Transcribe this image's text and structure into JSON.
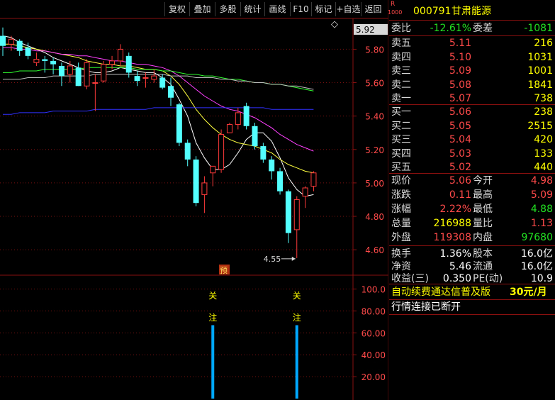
{
  "toolbar": {
    "buttons": [
      "复权",
      "叠加",
      "多股",
      "统计",
      "画线",
      "F10",
      "标记",
      "+自选",
      "返回"
    ]
  },
  "stock": {
    "badge_top": "R",
    "badge_bottom": "1000",
    "code": "000791",
    "name": "甘肃能源"
  },
  "price_axis": {
    "ticks": [
      "5.80",
      "5.60",
      "5.40",
      "5.20",
      "5.00",
      "4.80",
      "4.60"
    ],
    "current_tag": "5.92"
  },
  "chart_labels": {
    "low_label": "4.55",
    "preview_badge": "预",
    "diamond_icon": "◇"
  },
  "indicator": {
    "ticks": [
      "100.0",
      "80.00",
      "60.00",
      "40.00",
      "20.00"
    ],
    "marker_top": "关",
    "marker_bottom": "注"
  },
  "chart_data": {
    "type": "candlestick",
    "price_range": [
      4.52,
      5.98
    ],
    "candles": [
      {
        "o": 5.88,
        "h": 5.93,
        "l": 5.76,
        "c": 5.82
      },
      {
        "o": 5.83,
        "h": 5.88,
        "l": 5.79,
        "c": 5.86
      },
      {
        "o": 5.85,
        "h": 5.86,
        "l": 5.76,
        "c": 5.79
      },
      {
        "o": 5.81,
        "h": 5.84,
        "l": 5.74,
        "c": 5.76
      },
      {
        "o": 5.72,
        "h": 5.78,
        "l": 5.7,
        "c": 5.74
      },
      {
        "o": 5.74,
        "h": 5.76,
        "l": 5.66,
        "c": 5.73
      },
      {
        "o": 5.73,
        "h": 5.75,
        "l": 5.65,
        "c": 5.71
      },
      {
        "o": 5.7,
        "h": 5.72,
        "l": 5.58,
        "c": 5.64
      },
      {
        "o": 5.65,
        "h": 5.73,
        "l": 5.6,
        "c": 5.7
      },
      {
        "o": 5.69,
        "h": 5.72,
        "l": 5.58,
        "c": 5.58
      },
      {
        "o": 5.58,
        "h": 5.74,
        "l": 5.56,
        "c": 5.72
      },
      {
        "o": 5.6,
        "h": 5.65,
        "l": 5.43,
        "c": 5.6
      },
      {
        "o": 5.61,
        "h": 5.73,
        "l": 5.6,
        "c": 5.71
      },
      {
        "o": 5.71,
        "h": 5.76,
        "l": 5.68,
        "c": 5.73
      },
      {
        "o": 5.73,
        "h": 5.83,
        "l": 5.7,
        "c": 5.8
      },
      {
        "o": 5.76,
        "h": 5.78,
        "l": 5.63,
        "c": 5.66
      },
      {
        "o": 5.64,
        "h": 5.67,
        "l": 5.58,
        "c": 5.61
      },
      {
        "o": 5.63,
        "h": 5.66,
        "l": 5.57,
        "c": 5.63
      },
      {
        "o": 5.62,
        "h": 5.68,
        "l": 5.6,
        "c": 5.64
      },
      {
        "o": 5.63,
        "h": 5.65,
        "l": 5.56,
        "c": 5.57
      },
      {
        "o": 5.58,
        "h": 5.63,
        "l": 5.46,
        "c": 5.51
      },
      {
        "o": 5.47,
        "h": 5.48,
        "l": 5.22,
        "c": 5.24
      },
      {
        "o": 5.24,
        "h": 5.26,
        "l": 5.1,
        "c": 5.14
      },
      {
        "o": 5.14,
        "h": 5.16,
        "l": 4.86,
        "c": 4.88
      },
      {
        "o": 4.93,
        "h": 5.04,
        "l": 4.82,
        "c": 5.0
      },
      {
        "o": 5.06,
        "h": 5.08,
        "l": 4.98,
        "c": 5.1
      },
      {
        "o": 5.08,
        "h": 5.32,
        "l": 5.06,
        "c": 5.29
      },
      {
        "o": 5.3,
        "h": 5.36,
        "l": 5.3,
        "c": 5.35
      },
      {
        "o": 5.35,
        "h": 5.45,
        "l": 5.32,
        "c": 5.42
      },
      {
        "o": 5.46,
        "h": 5.48,
        "l": 5.32,
        "c": 5.34
      },
      {
        "o": 5.34,
        "h": 5.36,
        "l": 5.2,
        "c": 5.22
      },
      {
        "o": 5.22,
        "h": 5.24,
        "l": 5.12,
        "c": 5.14
      },
      {
        "o": 5.14,
        "h": 5.16,
        "l": 5.02,
        "c": 5.07
      },
      {
        "o": 5.07,
        "h": 5.09,
        "l": 4.93,
        "c": 4.95
      },
      {
        "o": 4.95,
        "h": 4.96,
        "l": 4.64,
        "c": 4.7
      },
      {
        "o": 4.72,
        "h": 4.92,
        "l": 4.55,
        "c": 4.9
      },
      {
        "o": 4.92,
        "h": 4.98,
        "l": 4.85,
        "c": 4.97
      },
      {
        "o": 4.98,
        "h": 5.07,
        "l": 4.95,
        "c": 5.06
      }
    ],
    "ma_series": [
      {
        "color": "#ffffff",
        "values": [
          5.88,
          5.87,
          5.84,
          5.82,
          5.8,
          5.78,
          5.75,
          5.73,
          5.71,
          5.69,
          5.67,
          5.66,
          5.66,
          5.67,
          5.69,
          5.68,
          5.67,
          5.66,
          5.66,
          5.63,
          5.59,
          5.5,
          5.4,
          5.24,
          5.15,
          5.08,
          5.08,
          5.11,
          5.18,
          5.26,
          5.3,
          5.3,
          5.25,
          5.15,
          5.03,
          4.96,
          4.92,
          4.93
        ]
      },
      {
        "color": "#ffff40",
        "values": [
          5.83,
          5.83,
          5.82,
          5.81,
          5.8,
          5.79,
          5.78,
          5.77,
          5.76,
          5.75,
          5.73,
          5.72,
          5.71,
          5.71,
          5.7,
          5.7,
          5.69,
          5.68,
          5.68,
          5.67,
          5.64,
          5.59,
          5.52,
          5.44,
          5.38,
          5.33,
          5.29,
          5.26,
          5.24,
          5.23,
          5.22,
          5.2,
          5.18,
          5.14,
          5.11,
          5.09,
          5.07,
          5.06
        ]
      },
      {
        "color": "#ff40ff",
        "values": [
          5.81,
          5.81,
          5.8,
          5.8,
          5.79,
          5.79,
          5.78,
          5.77,
          5.77,
          5.76,
          5.76,
          5.75,
          5.74,
          5.73,
          5.73,
          5.72,
          5.71,
          5.71,
          5.7,
          5.69,
          5.67,
          5.64,
          5.6,
          5.56,
          5.52,
          5.49,
          5.46,
          5.44,
          5.43,
          5.41,
          5.39,
          5.36,
          5.33,
          5.29,
          5.26,
          5.23,
          5.21,
          5.19
        ]
      },
      {
        "color": "#30ff30",
        "values": [
          5.66,
          5.66,
          5.67,
          5.67,
          5.67,
          5.68,
          5.68,
          5.68,
          5.68,
          5.68,
          5.69,
          5.69,
          5.69,
          5.69,
          5.69,
          5.69,
          5.68,
          5.68,
          5.68,
          5.67,
          5.67,
          5.66,
          5.65,
          5.65,
          5.64,
          5.64,
          5.63,
          5.62,
          5.62,
          5.61,
          5.6,
          5.6,
          5.59,
          5.59,
          5.58,
          5.57,
          5.56,
          5.55
        ]
      },
      {
        "color": "#c0c0c0",
        "values": [
          5.62,
          5.62,
          5.62,
          5.63,
          5.63,
          5.63,
          5.64,
          5.64,
          5.64,
          5.64,
          5.64,
          5.65,
          5.65,
          5.65,
          5.65,
          5.65,
          5.65,
          5.65,
          5.65,
          5.65,
          5.64,
          5.64,
          5.64,
          5.63,
          5.63,
          5.63,
          5.62,
          5.62,
          5.61,
          5.61,
          5.6,
          5.6,
          5.59,
          5.59,
          5.58,
          5.58,
          5.57,
          5.56
        ]
      },
      {
        "color": "#3030ff",
        "values": [
          5.41,
          5.41,
          5.42,
          5.42,
          5.42,
          5.42,
          5.43,
          5.43,
          5.43,
          5.43,
          5.43,
          5.44,
          5.44,
          5.44,
          5.44,
          5.44,
          5.44,
          5.44,
          5.45,
          5.45,
          5.45,
          5.45,
          5.45,
          5.45,
          5.45,
          5.45,
          5.45,
          5.45,
          5.45,
          5.45,
          5.45,
          5.45,
          5.44,
          5.44,
          5.44,
          5.44,
          5.44,
          5.44
        ]
      }
    ],
    "indicator_bars": [
      {
        "index": 25,
        "value": 67
      },
      {
        "index": 35,
        "value": 67
      }
    ],
    "indicator_range": [
      0,
      112
    ]
  },
  "quote": {
    "weibi_label": "委比",
    "weibi_value": "-12.61%",
    "weicha_label": "委差",
    "weicha_value": "-1081",
    "asks": [
      {
        "label": "卖五",
        "price": "5.11",
        "vol": "216"
      },
      {
        "label": "卖四",
        "price": "5.10",
        "vol": "1031"
      },
      {
        "label": "卖三",
        "price": "5.09",
        "vol": "1001"
      },
      {
        "label": "卖二",
        "price": "5.08",
        "vol": "1841"
      },
      {
        "label": "卖一",
        "price": "5.07",
        "vol": "738"
      }
    ],
    "bids": [
      {
        "label": "买一",
        "price": "5.06",
        "vol": "238"
      },
      {
        "label": "买二",
        "price": "5.05",
        "vol": "2515"
      },
      {
        "label": "买三",
        "price": "5.04",
        "vol": "420"
      },
      {
        "label": "买四",
        "price": "5.03",
        "vol": "133"
      },
      {
        "label": "买五",
        "price": "5.02",
        "vol": "440"
      }
    ],
    "stats": [
      {
        "l1": "现价",
        "v1": "5.06",
        "c1": "red",
        "l2": "今开",
        "v2": "4.98",
        "c2": "red"
      },
      {
        "l1": "涨跌",
        "v1": "0.11",
        "c1": "red",
        "l2": "最高",
        "v2": "5.09",
        "c2": "red"
      },
      {
        "l1": "涨幅",
        "v1": "2.22%",
        "c1": "red",
        "l2": "最低",
        "v2": "4.88",
        "c2": "green"
      },
      {
        "l1": "总量",
        "v1": "216988",
        "c1": "yellow",
        "l2": "量比",
        "v2": "1.13",
        "c2": "red"
      },
      {
        "l1": "外盘",
        "v1": "119308",
        "c1": "red",
        "l2": "内盘",
        "v2": "97680",
        "c2": "green"
      }
    ],
    "fundamentals": [
      {
        "l1": "换手",
        "v1": "1.36%",
        "l2": "股本",
        "v2": "16.0亿"
      },
      {
        "l1": "净资",
        "v1": "5.46",
        "l2": "流通",
        "v2": "16.0亿"
      },
      {
        "l1": "收益(三)",
        "v1": "0.350",
        "l2": "PE(动)",
        "v2": "10.9"
      }
    ],
    "promo_text": "自动续费通达信普及版",
    "promo_price": "30元/月",
    "status_text": "行情连接已断开"
  }
}
